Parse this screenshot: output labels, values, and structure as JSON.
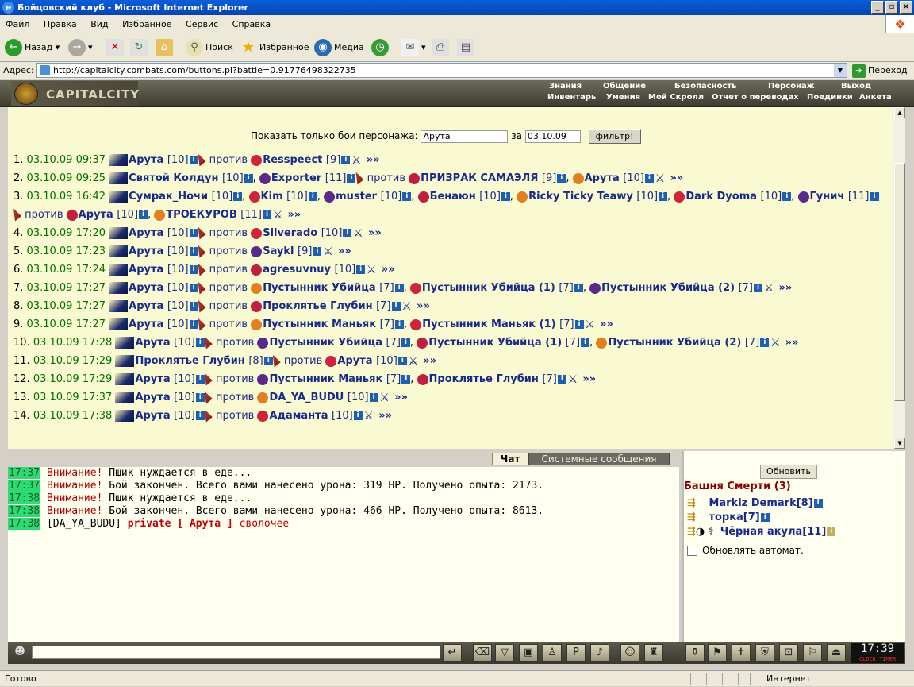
{
  "window": {
    "title": "Бойцовский клуб - Microsoft Internet Explorer"
  },
  "menu": [
    "Файл",
    "Правка",
    "Вид",
    "Избранное",
    "Сервис",
    "Справка"
  ],
  "toolbar": {
    "back": "Назад",
    "search": "Поиск",
    "favorites": "Избранное",
    "media": "Медиа"
  },
  "address": {
    "label": "Адрес:",
    "url": "http://capitalcity.combats.com/buttons.pl?battle=0.91776498322735",
    "go": "Переход"
  },
  "site": {
    "logo": "CAPITALCITY",
    "nav_top": [
      "Знания",
      "Общение",
      "Безопасность",
      "Персонаж",
      "Выход"
    ],
    "nav_bottom": [
      "Инвентарь",
      "Умения",
      "Мой Скролл",
      "Отчет о переводах",
      "Поединки",
      "Анкета"
    ]
  },
  "filter": {
    "label": "Показать только бои персонажа:",
    "name": "Арута",
    "za": "за",
    "date": "03.10.09",
    "button": "фильтр!"
  },
  "vs_word": "против",
  "battles": [
    {
      "n": "1.",
      "dt": "03.10.09 09:37",
      "a": "Арута [10]",
      "b": "Resspeect [9]"
    },
    {
      "n": "2.",
      "dt": "03.10.09 09:25",
      "a": "Святой Колдун [10], Exporter [11]",
      "b": "ПРИЗРАК САМАЭЛЯ [9], Арута [10]"
    },
    {
      "n": "3.",
      "dt": "03.10.09 16:42",
      "a": "Сумрак_Ночи [10], Kim [10], muster [10], Бенаюн [10], Ricky Ticky Teawy [10], Dark Dyoma [10], Гунич [11]",
      "b": "Арута [10], ТРОЕКУРОВ [11]"
    },
    {
      "n": "4.",
      "dt": "03.10.09 17:20",
      "a": "Арута [10]",
      "b": "Silverado [10]"
    },
    {
      "n": "5.",
      "dt": "03.10.09 17:23",
      "a": "Арута [10]",
      "b": "Saykl [9]"
    },
    {
      "n": "6.",
      "dt": "03.10.09 17:24",
      "a": "Арута [10]",
      "b": "agresuvnuy [10]"
    },
    {
      "n": "7.",
      "dt": "03.10.09 17:27",
      "a": "Арута [10]",
      "b": "Пустынник Убийца [7], Пустынник Убийца (1) [7], Пустынник Убийца (2) [7]"
    },
    {
      "n": "8.",
      "dt": "03.10.09 17:27",
      "a": "Арута [10]",
      "b": "Проклятье Глубин [7]"
    },
    {
      "n": "9.",
      "dt": "03.10.09 17:27",
      "a": "Арута [10]",
      "b": "Пустынник Маньяк [7], Пустынник Маньяк (1) [7]"
    },
    {
      "n": "10.",
      "dt": "03.10.09 17:28",
      "a": "Арута [10]",
      "b": "Пустынник Убийца [7], Пустынник Убийца (1) [7], Пустынник Убийца (2) [7]"
    },
    {
      "n": "11.",
      "dt": "03.10.09 17:29",
      "a": "Проклятье Глубин [8]",
      "b": "Арута [10]"
    },
    {
      "n": "12.",
      "dt": "03.10.09 17:29",
      "a": "Арута [10]",
      "b": "Пустынник Маньяк [7], Проклятье Глубин [7]"
    },
    {
      "n": "13.",
      "dt": "03.10.09 17:37",
      "a": "Арута [10]",
      "b": "DA_YA_BUDU [10]"
    },
    {
      "n": "14.",
      "dt": "03.10.09 17:38",
      "a": "Арута [10]",
      "b": "Адаманта [10]"
    }
  ],
  "more": "»»",
  "tabs": {
    "chat": "Чат",
    "system": "Системные сообщения"
  },
  "chat": [
    {
      "t": "17:37",
      "w": "Внимание!",
      "msg": "Пшик нуждается в еде..."
    },
    {
      "t": "17:37",
      "w": "Внимание!",
      "msg": "Бой закончен. Всего вами нанесено урона: 319 HP. Получено опыта: 2173."
    },
    {
      "t": "17:38",
      "w": "Внимание!",
      "msg": "Пшик нуждается в еде..."
    },
    {
      "t": "17:38",
      "w": "Внимание!",
      "msg": "Бой закончен. Всего вами нанесено урона: 466 HP. Получено опыта: 8613."
    }
  ],
  "chat_private": {
    "t": "17:38",
    "from": "[DA_YA_BUDU]",
    "to": "private [ Арута ]",
    "msg": "сволочее"
  },
  "side": {
    "refresh": "Обновить",
    "room": "Башня Смерти (3)",
    "players": [
      "Markiz Demark[8]",
      "торка[7]",
      "Чёрная акула[11]"
    ],
    "auto": "Обновлять автомат."
  },
  "clock": {
    "time": "17:39",
    "sub": "CLOCK TIMER"
  },
  "status": {
    "left": "Готово",
    "right": "Интернет"
  }
}
